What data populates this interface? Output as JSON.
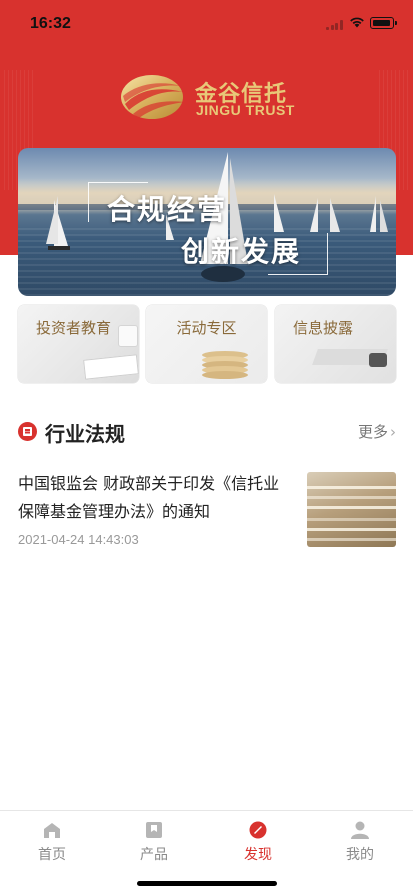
{
  "status_bar": {
    "time": "16:32",
    "battery_level": 0.85
  },
  "brand": {
    "name_cn": "金谷信托",
    "name_en": "JINGU TRUST"
  },
  "banner": {
    "line1": "合规经营",
    "line2": "创新发展"
  },
  "cards": [
    {
      "label": "投资者教育"
    },
    {
      "label": "活动专区"
    },
    {
      "label": "信息披露"
    }
  ],
  "section": {
    "title": "行业法规",
    "more": "更多"
  },
  "article": {
    "title": "中国银监会 财政部关于印发《信托业保障基金管理办法》的通知",
    "time": "2021-04-24 14:43:03"
  },
  "tabs": [
    {
      "label": "首页",
      "icon": "home-icon",
      "active": false
    },
    {
      "label": "产品",
      "icon": "product-icon",
      "active": false
    },
    {
      "label": "发现",
      "icon": "discover-icon",
      "active": true
    },
    {
      "label": "我的",
      "icon": "profile-icon",
      "active": false
    }
  ],
  "colors": {
    "brand_red": "#d8322e",
    "gold": "#e8c878",
    "inactive_tab": "#8a8a8a"
  }
}
